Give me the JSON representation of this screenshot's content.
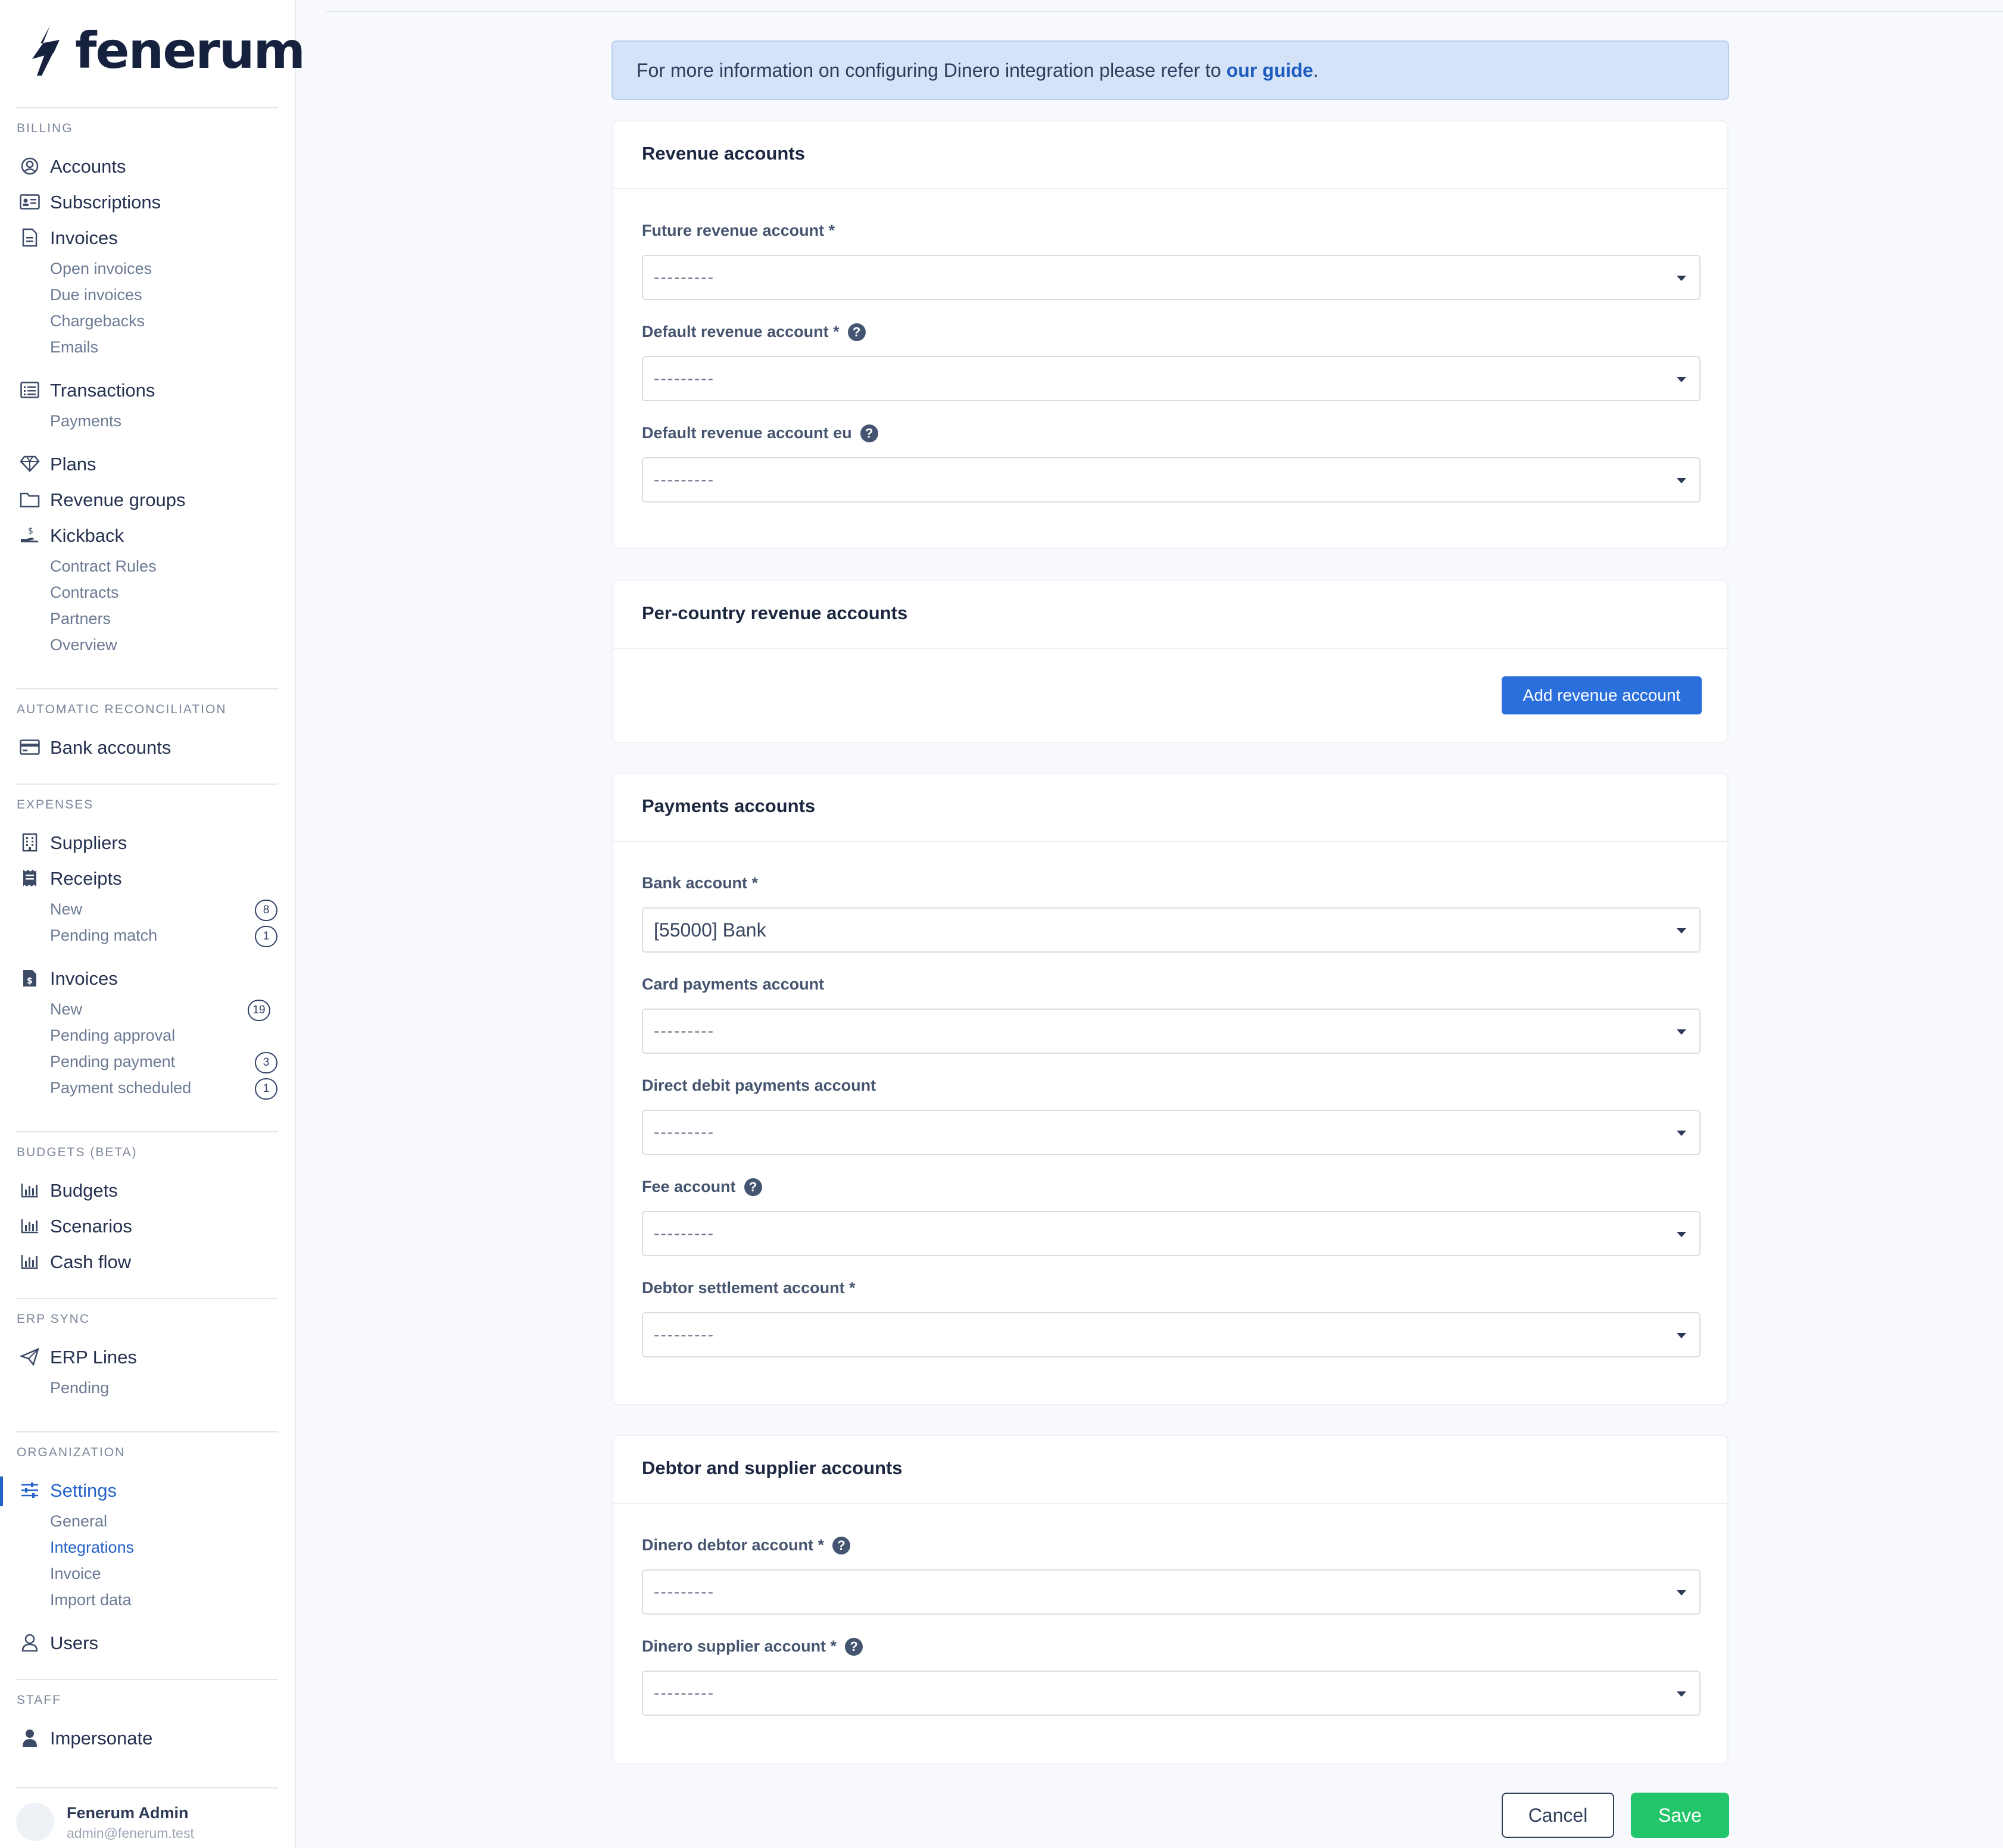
{
  "brand": {
    "name": "fenerum"
  },
  "sidebar": {
    "sections": {
      "billing": "BILLING",
      "auto_recon": "AUTOMATIC RECONCILIATION",
      "expenses": "EXPENSES",
      "budgets": "BUDGETS (BETA)",
      "erp_sync": "ERP SYNC",
      "organization": "ORGANIZATION",
      "staff": "STAFF"
    },
    "billing": {
      "accounts": "Accounts",
      "subscriptions": "Subscriptions",
      "invoices": "Invoices",
      "open_invoices": "Open invoices",
      "due_invoices": "Due invoices",
      "chargebacks": "Chargebacks",
      "emails": "Emails",
      "transactions": "Transactions",
      "payments": "Payments",
      "plans": "Plans",
      "revenue_groups": "Revenue groups",
      "kickback": "Kickback",
      "contract_rules": "Contract Rules",
      "contracts": "Contracts",
      "partners": "Partners",
      "overview": "Overview"
    },
    "auto_recon": {
      "bank_accounts": "Bank accounts"
    },
    "expenses": {
      "suppliers": "Suppliers",
      "receipts": "Receipts",
      "receipts_new": "New",
      "receipts_new_count": "8",
      "pending_match": "Pending match",
      "pending_match_count": "1",
      "invoices": "Invoices",
      "invoices_new": "New",
      "invoices_new_count": "19",
      "pending_approval": "Pending approval",
      "pending_payment": "Pending payment",
      "pending_payment_count": "3",
      "payment_scheduled": "Payment scheduled",
      "payment_scheduled_count": "1"
    },
    "budgets": {
      "budgets": "Budgets",
      "scenarios": "Scenarios",
      "cash_flow": "Cash flow"
    },
    "erp": {
      "erp_lines": "ERP Lines",
      "pending": "Pending"
    },
    "organization": {
      "settings": "Settings",
      "general": "General",
      "integrations": "Integrations",
      "invoice": "Invoice",
      "import_data": "Import data",
      "users": "Users"
    },
    "staff": {
      "impersonate": "Impersonate"
    },
    "user": {
      "name": "Fenerum Admin",
      "email": "admin@fenerum.test"
    }
  },
  "info_banner": {
    "text": "For more information on configuring Dinero integration please refer to ",
    "link": "our guide",
    "suffix": "."
  },
  "revenue_card": {
    "title": "Revenue accounts",
    "future_label": "Future revenue account *",
    "future_value": "---------",
    "default_label": "Default revenue account *",
    "default_value": "---------",
    "default_eu_label": "Default revenue account eu",
    "default_eu_value": "---------"
  },
  "per_country_card": {
    "title": "Per-country revenue accounts",
    "add_button": "Add revenue account"
  },
  "payments_card": {
    "title": "Payments accounts",
    "bank_label": "Bank account *",
    "bank_value": "[55000] Bank",
    "card_label": "Card payments account",
    "card_value": "---------",
    "direct_debit_label": "Direct debit payments account",
    "direct_debit_value": "---------",
    "fee_label": "Fee account",
    "fee_value": "---------",
    "debtor_settlement_label": "Debtor settlement account *",
    "debtor_settlement_value": "---------"
  },
  "debtor_card": {
    "title": "Debtor and supplier accounts",
    "debtor_label": "Dinero debtor account *",
    "debtor_value": "---------",
    "supplier_label": "Dinero supplier account *",
    "supplier_value": "---------"
  },
  "actions": {
    "cancel": "Cancel",
    "save": "Save"
  },
  "colors": {
    "accent": "#2563c9",
    "button_blue": "#2a6fdb",
    "save_green": "#22c56a",
    "banner": "#d4e3f8"
  },
  "icons": [
    "fenerum-logo",
    "user-circle-icon",
    "id-card-icon",
    "document-icon",
    "list-icon",
    "diamond-icon",
    "folder-icon",
    "hand-coin-icon",
    "credit-card-icon",
    "building-icon",
    "receipt-icon",
    "invoice-dollar-icon",
    "bar-chart-icon",
    "paper-plane-icon",
    "sliders-icon",
    "user-icon",
    "person-icon",
    "help-circle-icon",
    "caret-down-icon"
  ]
}
